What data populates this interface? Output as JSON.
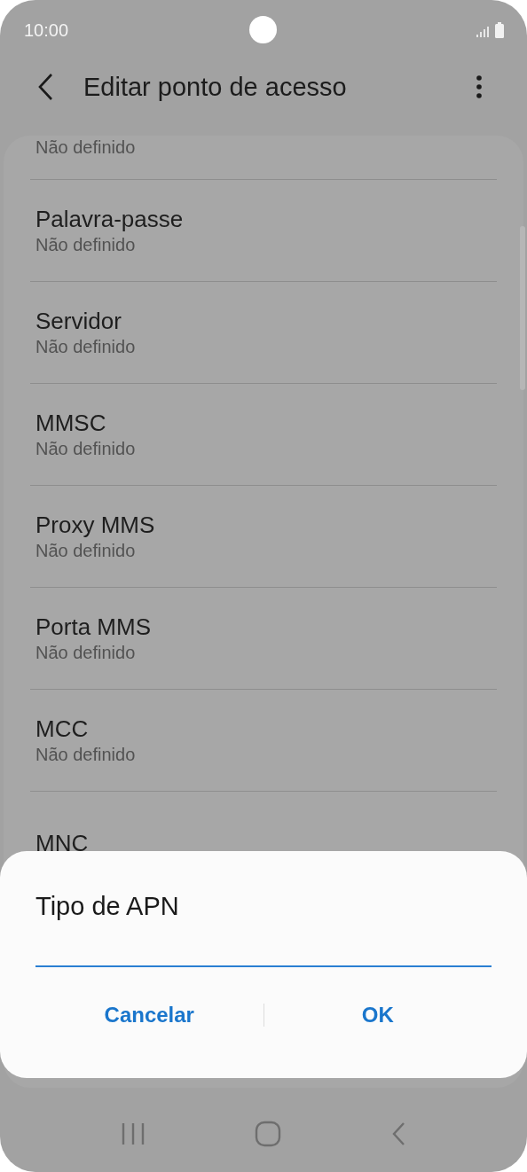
{
  "status_bar": {
    "time": "10:00"
  },
  "header": {
    "title": "Editar ponto de acesso"
  },
  "settings": [
    {
      "subtitle": "Não definido"
    },
    {
      "title": "Palavra-passe",
      "subtitle": "Não definido"
    },
    {
      "title": "Servidor",
      "subtitle": "Não definido"
    },
    {
      "title": "MMSC",
      "subtitle": "Não definido"
    },
    {
      "title": "Proxy MMS",
      "subtitle": "Não definido"
    },
    {
      "title": "Porta MMS",
      "subtitle": "Não definido"
    },
    {
      "title": "MCC",
      "subtitle": "Não definido"
    },
    {
      "title": "MNC"
    }
  ],
  "dialog": {
    "title": "Tipo de APN",
    "buttons": [
      "Cancelar",
      "OK"
    ]
  }
}
